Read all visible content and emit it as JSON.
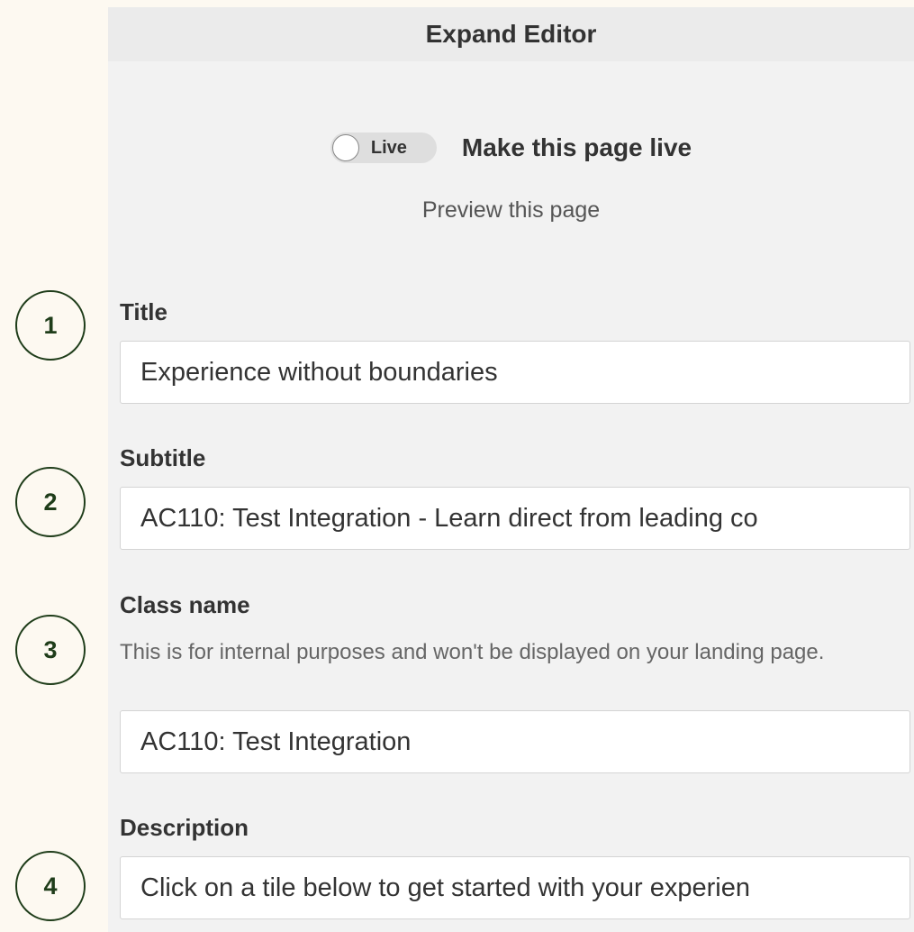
{
  "callouts": [
    "1",
    "2",
    "3",
    "4"
  ],
  "editor": {
    "header_title": "Expand Editor",
    "toggle": {
      "label": "Live",
      "state": "off"
    },
    "make_live_text": "Make this page live",
    "preview_link": "Preview this page"
  },
  "fields": {
    "title": {
      "label": "Title",
      "value": "Experience without boundaries"
    },
    "subtitle": {
      "label": "Subtitle",
      "value": "AC110: Test Integration - Learn direct from leading co"
    },
    "class_name": {
      "label": "Class name",
      "help": "This is for internal purposes and won't be displayed on your landing page.",
      "value": "AC110: Test Integration"
    },
    "description": {
      "label": "Description",
      "value": "Click on a tile below to get started with your experien"
    }
  },
  "colors": {
    "page_bg": "#fdf9f1",
    "panel_bg": "#f2f2f2",
    "callout_border": "#1f3d1a"
  }
}
